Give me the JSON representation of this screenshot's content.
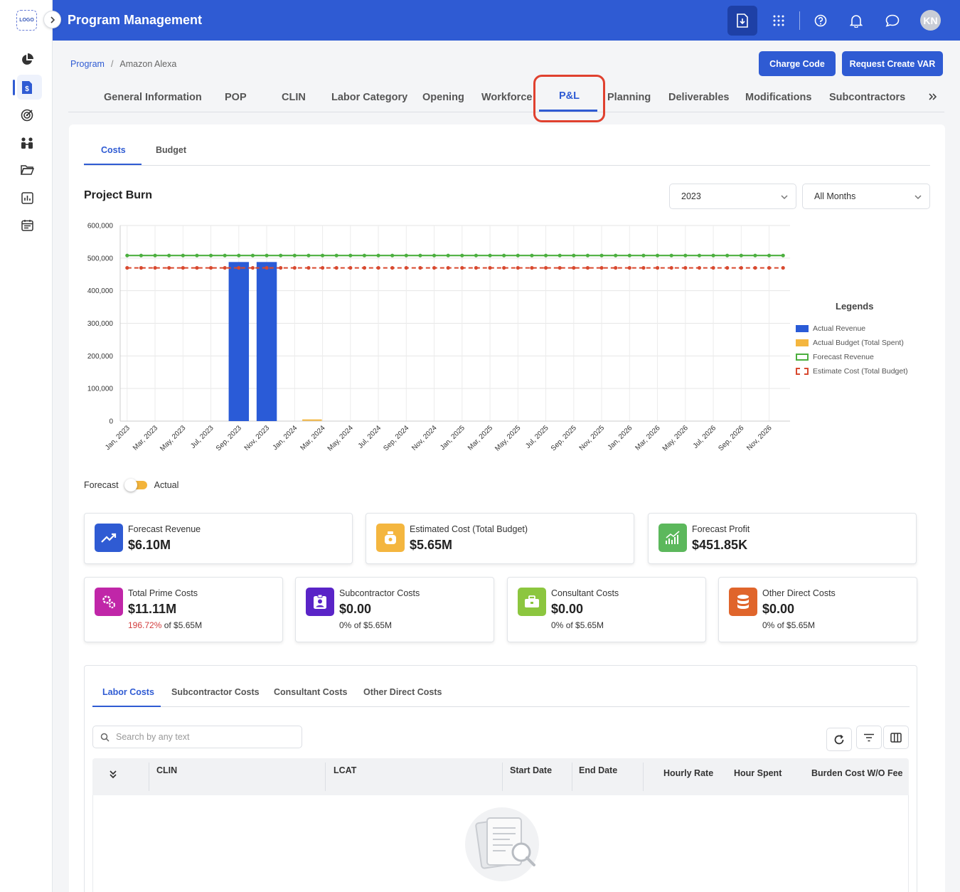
{
  "sidebar": {
    "logo_text": "LOGO",
    "icons": [
      "pie-chart-icon",
      "billing-document-icon",
      "target-icon",
      "team-icon",
      "folder-icon",
      "report-icon",
      "calendar-icon"
    ]
  },
  "header": {
    "title": "Program Management",
    "avatar_initials": "KN"
  },
  "breadcrumb": {
    "parent": "Program",
    "separator": "/",
    "current": "Amazon Alexa"
  },
  "actions": {
    "charge_code": "Charge Code",
    "request_var": "Request Create VAR"
  },
  "main_tabs": [
    "General Information",
    "POP",
    "CLIN",
    "Labor Category",
    "Opening",
    "Workforce",
    "P&L",
    "Planning",
    "Deliverables",
    "Modifications",
    "Subcontractors"
  ],
  "active_main_tab": "P&L",
  "sub_tabs": [
    "Costs",
    "Budget"
  ],
  "project_burn": {
    "title": "Project Burn",
    "year_select": "2023",
    "month_select": "All Months"
  },
  "chart_data": {
    "type": "bar",
    "categories": [
      "Jan, 2023",
      "Feb, 2023",
      "Mar, 2023",
      "Apr, 2023",
      "May, 2023",
      "Jun, 2023",
      "Jul, 2023",
      "Aug, 2023",
      "Sep, 2023",
      "Oct, 2023",
      "Nov, 2023",
      "Dec, 2023",
      "Jan, 2024",
      "Feb, 2024",
      "Mar, 2024",
      "Apr, 2024",
      "May, 2024",
      "Jun, 2024",
      "Jul, 2024",
      "Aug, 2024",
      "Sep, 2024",
      "Oct, 2024",
      "Nov, 2024",
      "Dec, 2024",
      "Jan, 2025",
      "Feb, 2025",
      "Mar, 2025",
      "Apr, 2025",
      "May, 2025",
      "Jun, 2025",
      "Jul, 2025",
      "Aug, 2025",
      "Sep, 2025",
      "Oct, 2025",
      "Nov, 2025",
      "Dec, 2025",
      "Jan, 2026",
      "Feb, 2026",
      "Mar, 2026",
      "Apr, 2026",
      "May, 2026",
      "Jun, 2026",
      "Jul, 2026",
      "Aug, 2026",
      "Sep, 2026",
      "Oct, 2026",
      "Nov, 2026",
      "Dec, 2026"
    ],
    "tick_labels": [
      "Jan, 2023",
      "Mar, 2023",
      "May, 2023",
      "Jul, 2023",
      "Sep, 2023",
      "Nov, 2023",
      "Jan, 2024",
      "Mar, 2024",
      "May, 2024",
      "Jul, 2024",
      "Sep, 2024",
      "Nov, 2024",
      "Jan, 2025",
      "Mar, 2025",
      "May, 2025",
      "Jul, 2025",
      "Sep, 2025",
      "Nov, 2025",
      "Jan, 2026",
      "Mar, 2026",
      "May, 2026",
      "Jul, 2026",
      "Sep, 2026",
      "Nov, 2026"
    ],
    "y_ticks": [
      "0",
      "100,000",
      "200,000",
      "300,000",
      "400,000",
      "500,000",
      "600,000"
    ],
    "ylim": [
      0,
      600000
    ],
    "grid": true,
    "legend_title": "Legends",
    "legend_position": "right",
    "series": [
      {
        "name": "Actual Revenue",
        "kind": "bar",
        "color": "#2a5bd7",
        "values": [
          0,
          0,
          0,
          0,
          0,
          0,
          0,
          0,
          488000,
          0,
          488000,
          0,
          0,
          0,
          0,
          0,
          0,
          0,
          0,
          0,
          0,
          0,
          0,
          0,
          0,
          0,
          0,
          0,
          0,
          0,
          0,
          0,
          0,
          0,
          0,
          0,
          0,
          0,
          0,
          0,
          0,
          0,
          0,
          0,
          0,
          0,
          0,
          0
        ]
      },
      {
        "name": "Actual Budget (Total Spent)",
        "kind": "bar",
        "color": "#f4b63f",
        "values": [
          0,
          0,
          0,
          0,
          0,
          0,
          0,
          0,
          0,
          0,
          0,
          0,
          3000,
          0,
          0,
          0,
          0,
          0,
          0,
          0,
          0,
          0,
          0,
          0,
          0,
          0,
          0,
          0,
          0,
          0,
          0,
          0,
          0,
          0,
          0,
          0,
          0,
          0,
          0,
          0,
          0,
          0,
          0,
          0,
          0,
          0,
          0,
          0
        ]
      },
      {
        "name": "Forecast Revenue",
        "kind": "line",
        "color": "#4caf3f",
        "value_constant": 508000
      },
      {
        "name": "Estimate Cost (Total Budget)",
        "kind": "dashed-line",
        "color": "#d8492f",
        "value_constant": 470000
      }
    ]
  },
  "toggle": {
    "left": "Forecast",
    "right": "Actual"
  },
  "stats_top": [
    {
      "label": "Forecast Revenue",
      "value": "$6.10M",
      "color": "#2f5bd3",
      "icon": "trending-up-icon"
    },
    {
      "label": "Estimated Cost (Total Budget)",
      "value": "$5.65M",
      "color": "#f4b63f",
      "icon": "money-bag-icon"
    },
    {
      "label": "Forecast Profit",
      "value": "$451.85K",
      "color": "#5cb85c",
      "icon": "growth-chart-icon"
    }
  ],
  "stats_bottom": [
    {
      "label": "Total Prime Costs",
      "value": "$11.11M",
      "pct": "196.72%",
      "of": "of $5.65M",
      "color": "#c026a8",
      "icon": "gears-icon"
    },
    {
      "label": "Subcontractor Costs",
      "value": "$0.00",
      "pct": "0%",
      "of": "of $5.65M",
      "color": "#5a24c7",
      "icon": "contact-card-icon"
    },
    {
      "label": "Consultant Costs",
      "value": "$0.00",
      "pct": "0%",
      "of": "of $5.65M",
      "color": "#8cc63f",
      "icon": "briefcase-icon"
    },
    {
      "label": "Other Direct Costs",
      "value": "$0.00",
      "pct": "0%",
      "of": "of $5.65M",
      "color": "#e0652b",
      "icon": "database-icon"
    }
  ],
  "lower_tabs": [
    "Labor Costs",
    "Subcontractor Costs",
    "Consultant Costs",
    "Other Direct Costs"
  ],
  "search": {
    "placeholder": "Search by any text"
  },
  "table": {
    "columns": [
      "CLIN",
      "LCAT",
      "Start Date",
      "End Date",
      "Hourly Rate",
      "Hour Spent",
      "Burden Cost W/O Fee"
    ]
  }
}
